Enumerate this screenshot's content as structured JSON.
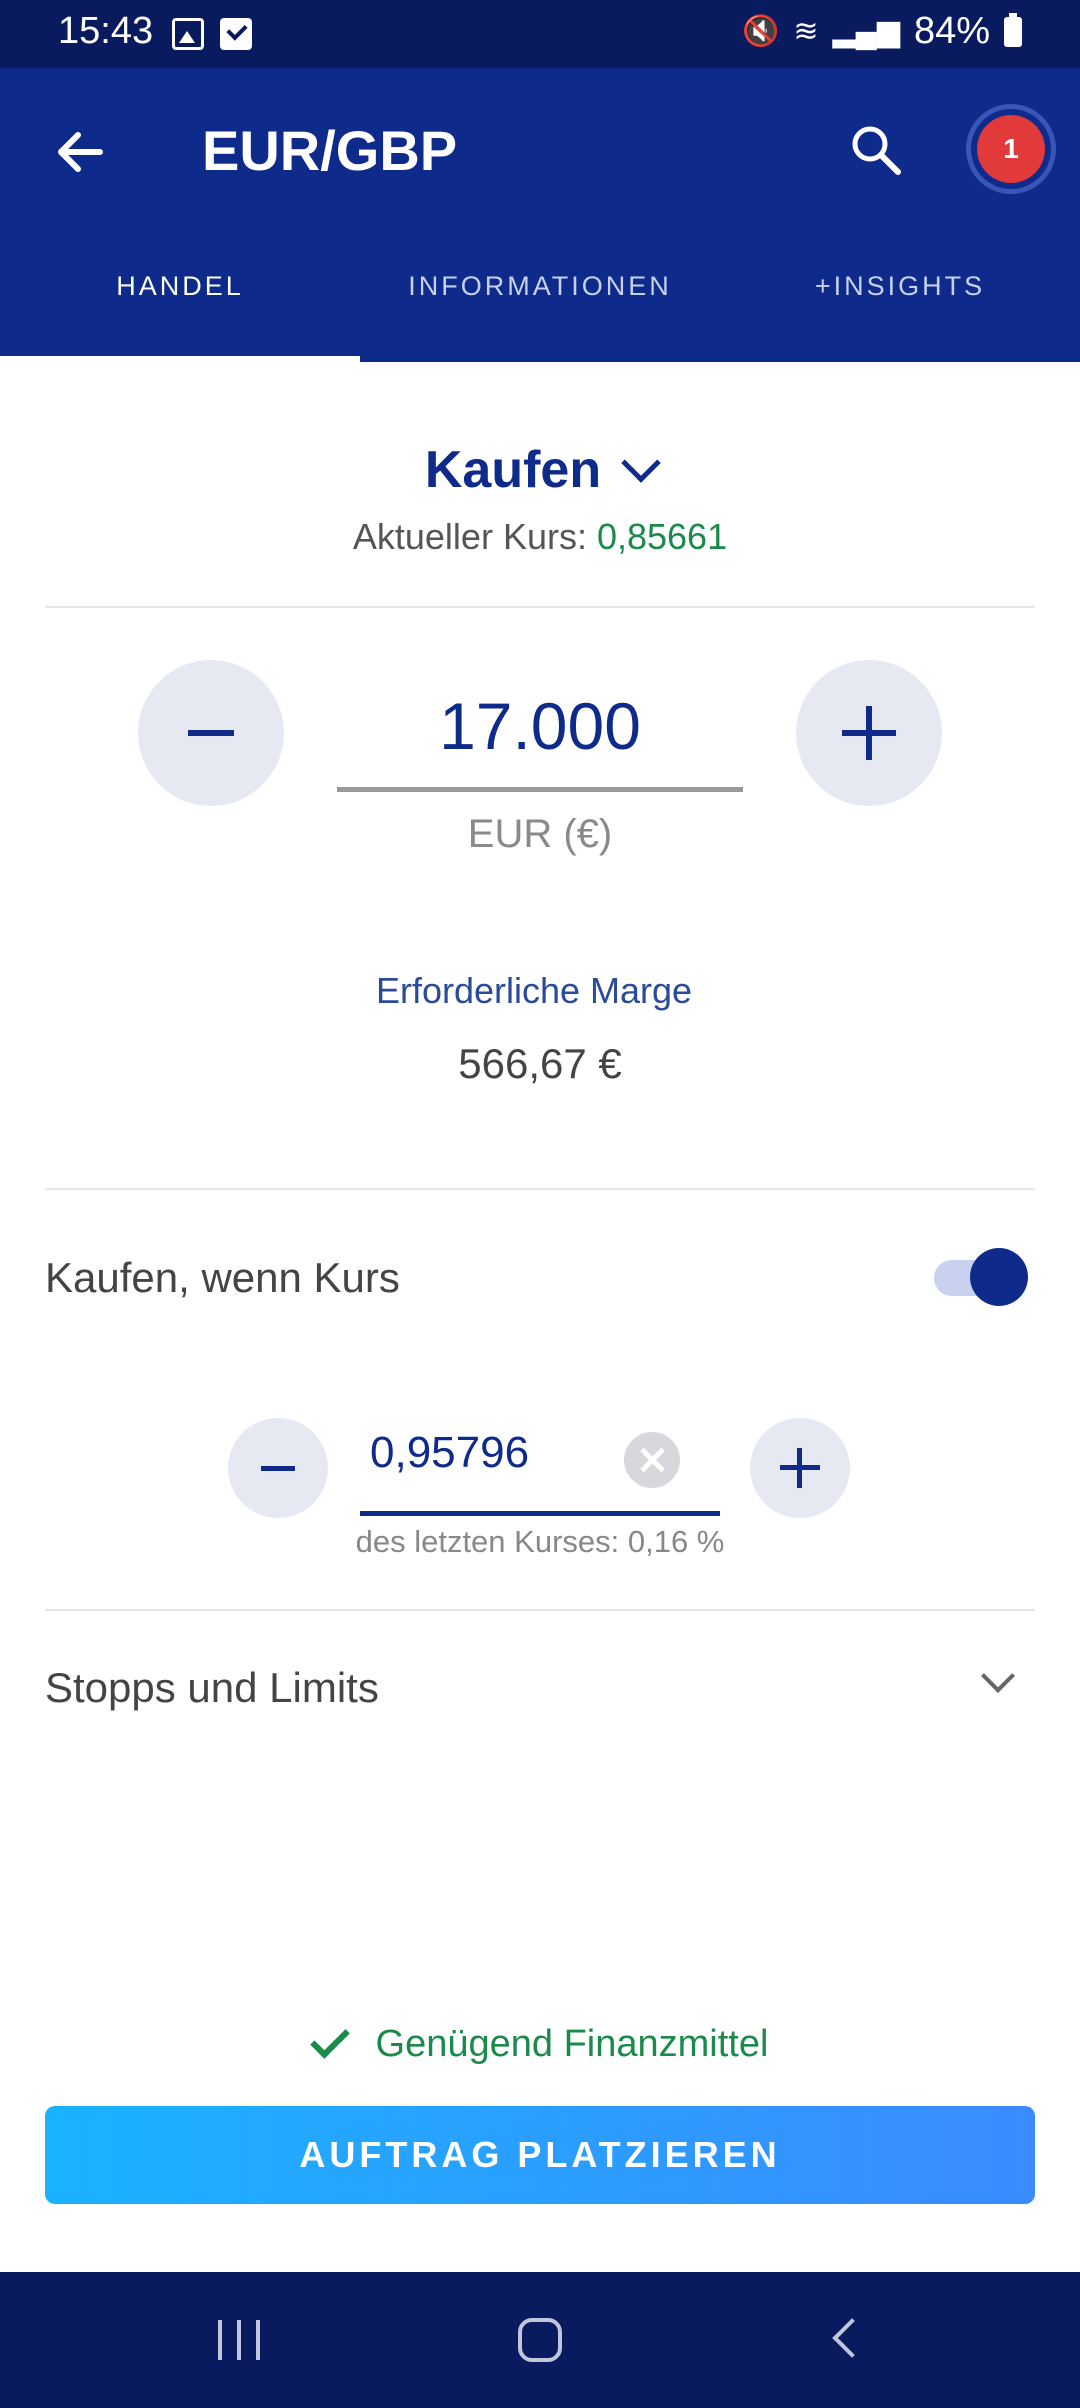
{
  "status_bar": {
    "time": "15:43",
    "battery": "84%",
    "icons": [
      "photo-icon",
      "task-icon",
      "mute-icon",
      "wifi-icon",
      "signal-icon",
      "battery-icon"
    ]
  },
  "header": {
    "title": "EUR/GBP",
    "notification_count": "1"
  },
  "tabs": [
    {
      "label": "HANDEL",
      "active": true
    },
    {
      "label": "INFORMATIONEN",
      "active": false
    },
    {
      "label": "+INSIGHTS",
      "active": false
    }
  ],
  "trade": {
    "direction": "Kaufen",
    "current_rate_label": "Aktueller Kurs: ",
    "current_rate_value": "0,85661",
    "amount": "17.000",
    "amount_unit": "EUR (€)",
    "margin_label": "Erforderliche Marge",
    "margin_value": "566,67 €"
  },
  "condition": {
    "label": "Kaufen, wenn Kurs",
    "toggle_on": true,
    "limit_value": "0,95796",
    "hint": "des letzten Kurses: 0,16 %"
  },
  "stops": {
    "label": "Stopps und Limits"
  },
  "funds": {
    "label": "Genügend Finanzmittel"
  },
  "actions": {
    "place_order": "AUFTRAG PLATZIEREN"
  },
  "colors": {
    "header_bg": "#0e2a8a",
    "status_bg": "#0a1a5e",
    "positive": "#1b8a4a",
    "badge": "#e23a3a",
    "button_gradient_start": "#1ab2ff",
    "button_gradient_end": "#3a8bff"
  }
}
